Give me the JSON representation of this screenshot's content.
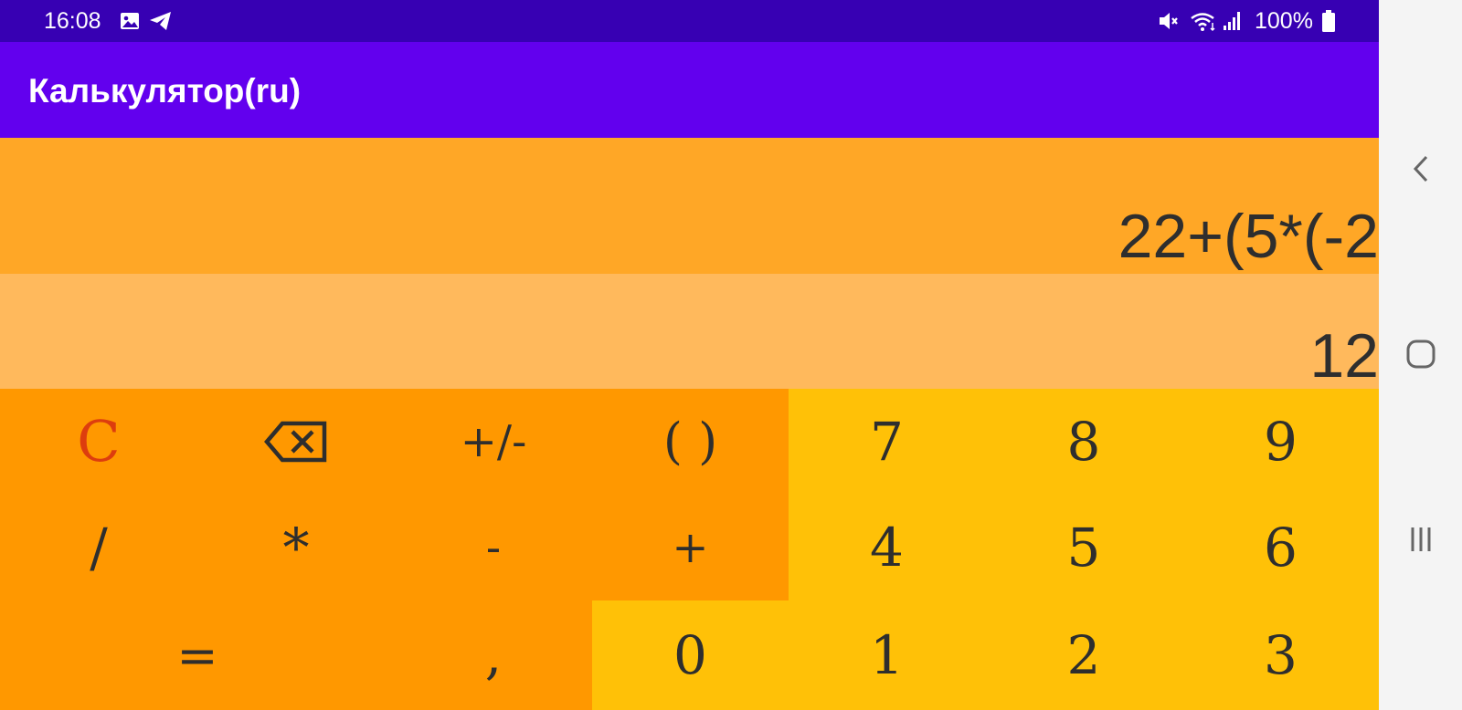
{
  "status_bar": {
    "time": "16:08",
    "battery": "100%",
    "icons": [
      "gallery-icon",
      "telegram-icon",
      "mute-icon",
      "wifi-icon",
      "signal-icon",
      "battery-icon"
    ]
  },
  "app_bar": {
    "title": "Калькулятор(ru)"
  },
  "display": {
    "expression": "22+(5*(-2",
    "result": "12"
  },
  "keypad": {
    "clear": "C",
    "backspace_icon": "backspace-icon",
    "sign": "+/-",
    "parentheses": "( )",
    "divide": "/",
    "multiply": "*",
    "minus": "-",
    "plus": "+",
    "equals": "=",
    "comma": ",",
    "digits": {
      "d0": "0",
      "d1": "1",
      "d2": "2",
      "d3": "3",
      "d4": "4",
      "d5": "5",
      "d6": "6",
      "d7": "7",
      "d8": "8",
      "d9": "9"
    }
  },
  "nav_bar": {
    "icons": [
      "back-icon",
      "home-icon",
      "recents-icon"
    ]
  },
  "colors": {
    "status_bar": "#3700b3",
    "app_bar": "#6200ee",
    "expression_bg": "#ffa726",
    "result_bg": "#ffb95c",
    "operator_keys": "#ff9800",
    "digit_keys": "#ffc107",
    "clear_text": "#dd3d0e"
  }
}
